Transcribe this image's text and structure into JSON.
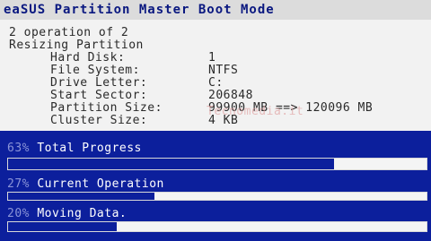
{
  "window": {
    "title": "eaSUS Partition Master Boot Mode"
  },
  "operation": {
    "header": "2 operation of 2",
    "action": "Resizing Partition",
    "fields": [
      {
        "label": "Hard Disk:",
        "value": "1"
      },
      {
        "label": "File System:",
        "value": "NTFS"
      },
      {
        "label": "Drive Letter:",
        "value": "C:"
      },
      {
        "label": "Start Sector:",
        "value": "206848"
      },
      {
        "label": "Partition Size:",
        "value": "99900 MB ==> 120096 MB"
      },
      {
        "label": "Cluster Size:",
        "value": "4 KB"
      }
    ]
  },
  "watermark": "Tecnomedia.it",
  "progress": {
    "total": {
      "percent_label": "63%",
      "label": "Total Progress",
      "fraction": 0.78
    },
    "current": {
      "percent_label": "27%",
      "label": "Current Operation",
      "fraction": 0.35
    },
    "moving": {
      "percent_label": "20%",
      "label": "Moving Data.",
      "fraction": 0.26
    }
  },
  "colors": {
    "background": "#0c1f9c",
    "panel": "#f2f2f2",
    "title_bar": "#dcdcdc"
  }
}
